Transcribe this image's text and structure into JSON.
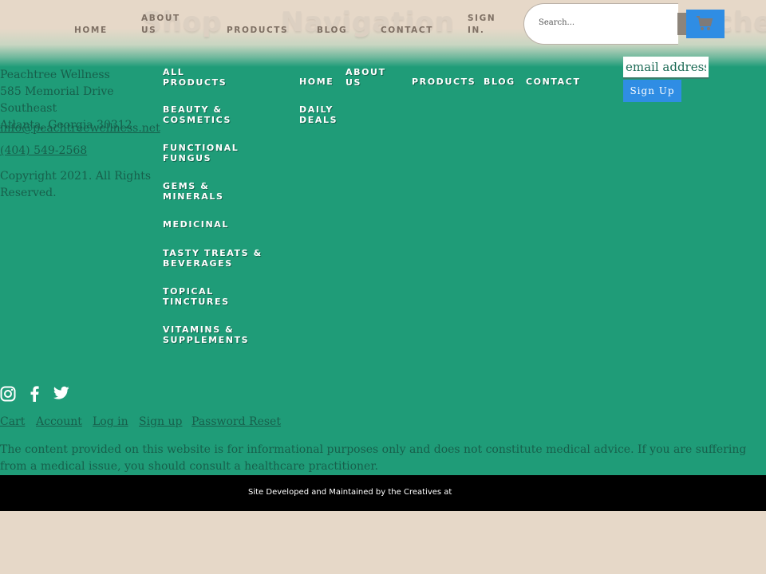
{
  "header": {
    "ghost_titles": [
      "Shop",
      "Navigation"
    ],
    "ghost_right": "ches",
    "nav": [
      {
        "label": "HOME"
      },
      {
        "label": "ABOUT US"
      },
      {
        "label": "PRODUCTS"
      },
      {
        "label": "BLOG"
      },
      {
        "label": "CONTACT"
      },
      {
        "label": "SIGN IN."
      }
    ],
    "search_placeholder": "Search...",
    "cart_icon": "cart-icon"
  },
  "footer": {
    "address": [
      "Peachtree Wellness",
      "585 Memorial Drive Southeast",
      "Atlanta, Georgia 30312"
    ],
    "email": "info@peachtreewellness.net",
    "phone": "(404) 549-2568",
    "copyright": "Copyright 2021. All Rights Reserved.",
    "categories": [
      "ALL PRODUCTS",
      "BEAUTY & COSMETICS",
      "FUNCTIONAL FUNGUS",
      "GEMS & MINERALS",
      "MEDICINAL",
      "TASTY TREATS & BEVERAGES",
      "TOPICAL TINCTURES",
      "VITAMINS & SUPPLEMENTS"
    ],
    "nav2": [
      "HOME",
      "DAILY DEALS"
    ],
    "nav3": [
      "ABOUT US",
      "PRODUCTS",
      "BLOG",
      "CONTACT"
    ],
    "newsletter": {
      "placeholder": "email address",
      "button": "Sign Up"
    },
    "social": [
      "instagram-icon",
      "facebook-icon",
      "twitter-icon"
    ],
    "account_links": [
      "Cart",
      "Account",
      "Log in",
      "Sign up",
      "Password Reset"
    ],
    "disclaimer": "The content provided on this website is for informational purposes only and does not constitute medical advice. If you are suffering from a medical issue, you should consult a healthcare practitioner.",
    "credits": "Site Developed and Maintained by the Creatives at"
  },
  "colors": {
    "accent": "#2f8de4",
    "footer_bg": "#1f9c78",
    "page_bg": "#e6d8c8",
    "footer_text": "#175f4b"
  }
}
